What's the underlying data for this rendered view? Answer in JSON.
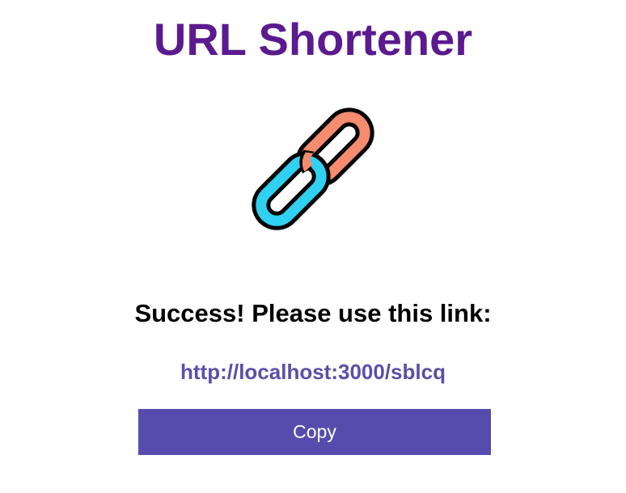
{
  "app": {
    "title": "URL Shortener"
  },
  "logo": {
    "icon": "chain-link-icon",
    "colors": {
      "link_front": "#2fd0f0",
      "link_back": "#f58c6e",
      "outline": "#000000"
    }
  },
  "result": {
    "message": "Success! Please use this link:",
    "short_url": "http://localhost:3000/sblcq"
  },
  "actions": {
    "copy_label": "Copy"
  },
  "theme": {
    "title_color": "#5b1a8f",
    "link_color": "#5a4fa8",
    "button_color": "#564cad"
  }
}
